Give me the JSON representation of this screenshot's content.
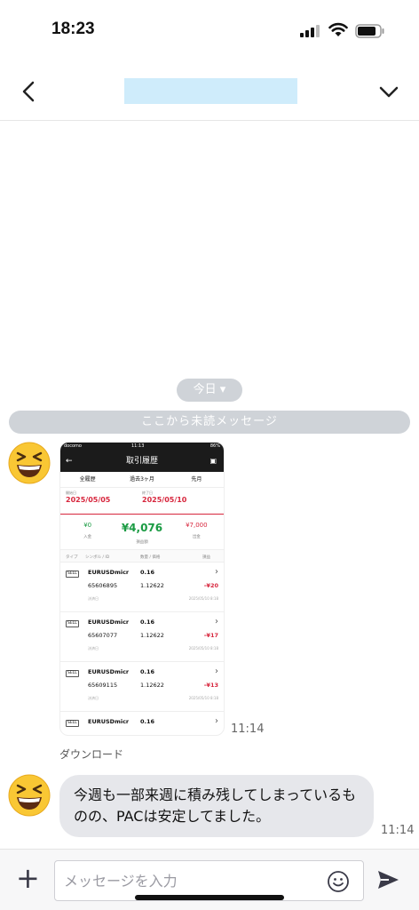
{
  "status": {
    "time": "18:23"
  },
  "header": {
    "title": ""
  },
  "chat": {
    "date_chip": "今日 ▾",
    "unread_divider": "ここから未読メッセージ",
    "image_time": "11:14",
    "download_label": "ダウンロード",
    "text_message": "今週も一部来週に積み残してしまっているものの、PACは安定してました。",
    "text_time": "11:14"
  },
  "screenshot": {
    "carrier": "docomo",
    "clock": "11:13",
    "battery": "86%",
    "title": "取引履歴",
    "tabs": [
      "全履歴",
      "過去3ヶ月",
      "先月"
    ],
    "start_label": "開始日",
    "start_date": "2025/05/05",
    "end_label": "終了日",
    "end_date": "2025/05/10",
    "deposit": "¥0",
    "deposit_label": "入金",
    "pnl": "¥4,076",
    "pnl_label": "損益額",
    "withdraw": "¥7,000",
    "withdraw_label": "出金",
    "col_type": "タイプ",
    "col_symbol": "シンボル / ID",
    "col_qty": "数量 / 価格",
    "col_pl": "損益",
    "rows": [
      {
        "tag": "SELL",
        "symbol": "EURUSDmicr",
        "qty": "0.16",
        "id": "65606895",
        "price": "1.12622",
        "pl": "-¥20",
        "status": "決済日",
        "date": "2025/05/10 8:18"
      },
      {
        "tag": "SELL",
        "symbol": "EURUSDmicr",
        "qty": "0.16",
        "id": "65607077",
        "price": "1.12622",
        "pl": "-¥17",
        "status": "決済日",
        "date": "2025/05/10 8:18"
      },
      {
        "tag": "SELL",
        "symbol": "EURUSDmicr",
        "qty": "0.16",
        "id": "65609115",
        "price": "1.12622",
        "pl": "-¥13",
        "status": "決済日",
        "date": "2025/05/10 8:18"
      },
      {
        "tag": "SELL",
        "symbol": "EURUSDmicr",
        "qty": "0.16",
        "id": "",
        "price": "",
        "pl": "",
        "status": "",
        "date": ""
      }
    ]
  },
  "composer": {
    "placeholder": "メッセージを入力"
  },
  "icons": [
    "back-icon",
    "chevron-down-icon",
    "emoji-avatar-icon",
    "plus-icon",
    "smiley-icon",
    "send-icon"
  ]
}
